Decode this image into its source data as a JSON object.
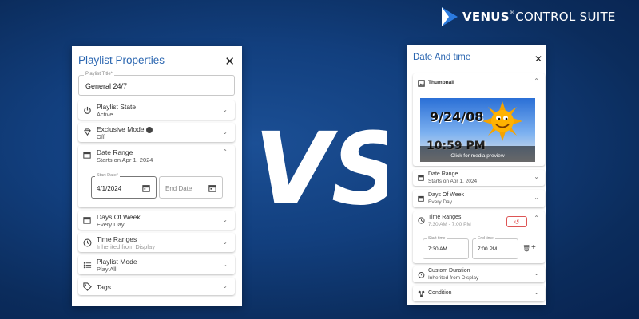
{
  "logo": {
    "brand": "VENUS",
    "rest": "CONTROL SUITE",
    "mark_color": "#2b7be0"
  },
  "vs_text": "VS",
  "left": {
    "title": "Playlist Properties",
    "title_field": {
      "label": "Playlist Title*",
      "value": "General 24/7"
    },
    "state": {
      "title": "Playlist State",
      "value": "Active",
      "icon": "power-icon"
    },
    "exclusive": {
      "title": "Exclusive Mode",
      "value": "Off",
      "icon": "diamond-icon"
    },
    "date_range": {
      "title": "Date Range",
      "value": "Starts on Apr 1, 2024",
      "icon": "calendar-icon",
      "start_label": "Start Date*",
      "start_value": "4/1/2024",
      "end_placeholder": "End Date"
    },
    "days": {
      "title": "Days Of Week",
      "value": "Every Day",
      "icon": "calendar-icon"
    },
    "time_ranges": {
      "title": "Time Ranges",
      "value": "Inherited from Display",
      "icon": "clock-icon"
    },
    "mode": {
      "title": "Playlist Mode",
      "value": "Play All",
      "icon": "list-icon"
    },
    "tags": {
      "title": "Tags",
      "icon": "tag-icon"
    }
  },
  "right": {
    "title": "Date And time",
    "thumbnail": {
      "title": "Thumbnail",
      "icon": "image-icon",
      "date_text": "9/24/08",
      "time_text": "10:59 PM",
      "caption": "Click for media preview"
    },
    "date_range": {
      "title": "Date Range",
      "value": "Starts on Apr 1, 2024"
    },
    "days": {
      "title": "Days Of Week",
      "value": "Every Day"
    },
    "time_ranges": {
      "title": "Time Ranges",
      "value": "7:30 AM - 7:00 PM",
      "start_label": "Start time",
      "start_value": "7:30 AM",
      "end_label": "End time",
      "end_value": "7:00 PM"
    },
    "custom_duration": {
      "title": "Custom Duration",
      "value": "Inherited from Display"
    },
    "condition": {
      "title": "Condition"
    }
  },
  "colors": {
    "accent": "#2b66b0",
    "danger": "#d33333",
    "bg": "#123f7e"
  }
}
